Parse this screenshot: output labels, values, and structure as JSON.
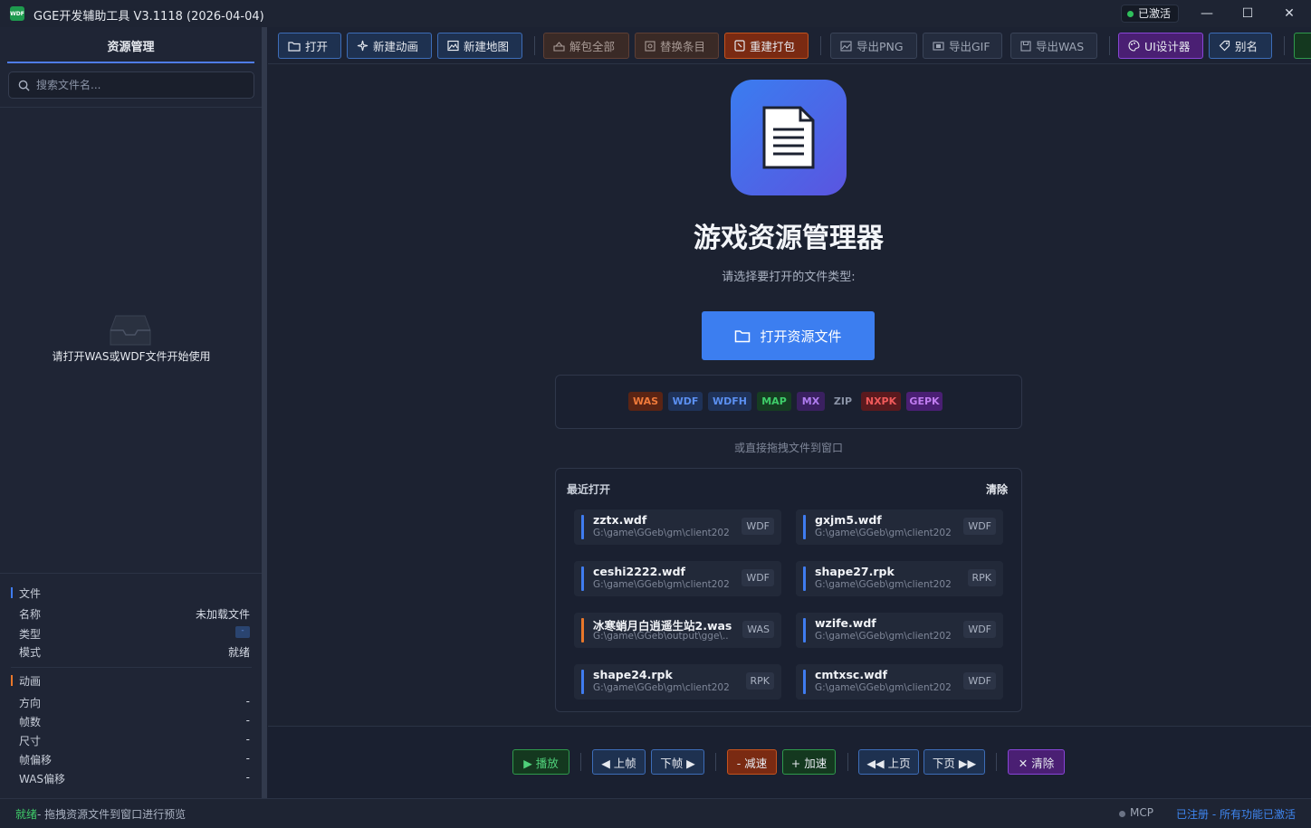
{
  "window": {
    "logo_text": "WDF",
    "title": "GGE开发辅助工具 V3.1118 (2026-04-04)",
    "activated_label": "已激活",
    "minimize_glyph": "—",
    "maximize_glyph": "☐",
    "close_glyph": "✕"
  },
  "sidebar": {
    "tab_label": "资源管理",
    "search_placeholder": "搜索文件名...",
    "empty_text": "请打开WAS或WDF文件开始使用",
    "file_section": {
      "title": "文件",
      "accent_color": "#3f7cf0",
      "rows": [
        {
          "label": "名称",
          "value": "未加载文件"
        },
        {
          "label": "类型",
          "value": "-"
        },
        {
          "label": "模式",
          "value": "就绪"
        }
      ]
    },
    "anim_section": {
      "title": "动画",
      "accent_color": "#e8772a",
      "rows": [
        {
          "label": "方向",
          "value": "-"
        },
        {
          "label": "帧数",
          "value": "-"
        },
        {
          "label": "尺寸",
          "value": "-"
        },
        {
          "label": "帧偏移",
          "value": "-"
        },
        {
          "label": "WAS偏移",
          "value": "-"
        }
      ]
    }
  },
  "toolbar": {
    "open": "打开",
    "new_anim": "新建动画",
    "new_map": "新建地图",
    "unpack_all": "解包全部",
    "replace_entry": "替换条目",
    "repack": "重建打包",
    "export_png": "导出PNG",
    "export_gif": "导出GIF",
    "export_was": "导出WAS",
    "ui_designer": "UI设计器",
    "alias": "别名"
  },
  "main": {
    "title": "游戏资源管理器",
    "subtitle": "请选择要打开的文件类型:",
    "open_button": "打开资源文件",
    "file_types": [
      {
        "label": "WAS",
        "color": "#f07a3a",
        "bg": "#5a2414"
      },
      {
        "label": "WDF",
        "color": "#5b8ff0",
        "bg": "#1f3258"
      },
      {
        "label": "WDFH",
        "color": "#5b8ff0",
        "bg": "#1f3258"
      },
      {
        "label": "MAP",
        "color": "#3fce6a",
        "bg": "#163d22"
      },
      {
        "label": "MX",
        "color": "#b07cf0",
        "bg": "#3a2060"
      },
      {
        "label": "ZIP",
        "color": "#8a93a6",
        "bg": "transparent"
      },
      {
        "label": "NXPK",
        "color": "#f05a5a",
        "bg": "#5a1a1e"
      },
      {
        "label": "GEPK",
        "color": "#c07cf0",
        "bg": "#4a1f73"
      }
    ],
    "drag_hint": "或直接拖拽文件到窗口",
    "recent": {
      "title": "最近打开",
      "clear": "清除",
      "items": [
        {
          "name": "zztx.wdf",
          "path": "G:\\game\\GGeb\\gm\\client202...",
          "type": "WDF",
          "accent": "#3f7cf0"
        },
        {
          "name": "gxjm5.wdf",
          "path": "G:\\game\\GGeb\\gm\\client202...",
          "type": "WDF",
          "accent": "#3f7cf0"
        },
        {
          "name": "ceshi2222.wdf",
          "path": "G:\\game\\GGeb\\gm\\client202...",
          "type": "WDF",
          "accent": "#3f7cf0"
        },
        {
          "name": "shape27.rpk",
          "path": "G:\\game\\GGeb\\gm\\client202...",
          "type": "RPK",
          "accent": "#3f7cf0"
        },
        {
          "name": "冰寒蛸月白逍遥生站2.was",
          "path": "G:\\game\\GGeb\\output\\gge\\...",
          "type": "WAS",
          "accent": "#e8772a"
        },
        {
          "name": "wzife.wdf",
          "path": "G:\\game\\GGeb\\gm\\client202...",
          "type": "WDF",
          "accent": "#3f7cf0"
        },
        {
          "name": "shape24.rpk",
          "path": "G:\\game\\GGeb\\gm\\client202...",
          "type": "RPK",
          "accent": "#3f7cf0"
        },
        {
          "name": "cmtxsc.wdf",
          "path": "G:\\game\\GGeb\\gm\\client202...",
          "type": "WDF",
          "accent": "#3f7cf0"
        }
      ]
    }
  },
  "playback": {
    "play": "▶ 播放",
    "prev_frame": "◀ 上帧",
    "next_frame": "下帧 ▶",
    "slower": "- 减速",
    "faster": "+ 加速",
    "prev_page": "◀◀ 上页",
    "next_page": "下页 ▶▶",
    "clear": "✕ 清除"
  },
  "status": {
    "ready": "就绪",
    "message": "- 拖拽资源文件到窗口进行预览",
    "mcp": "MCP",
    "registered": "已注册 - 所有功能已激活"
  }
}
